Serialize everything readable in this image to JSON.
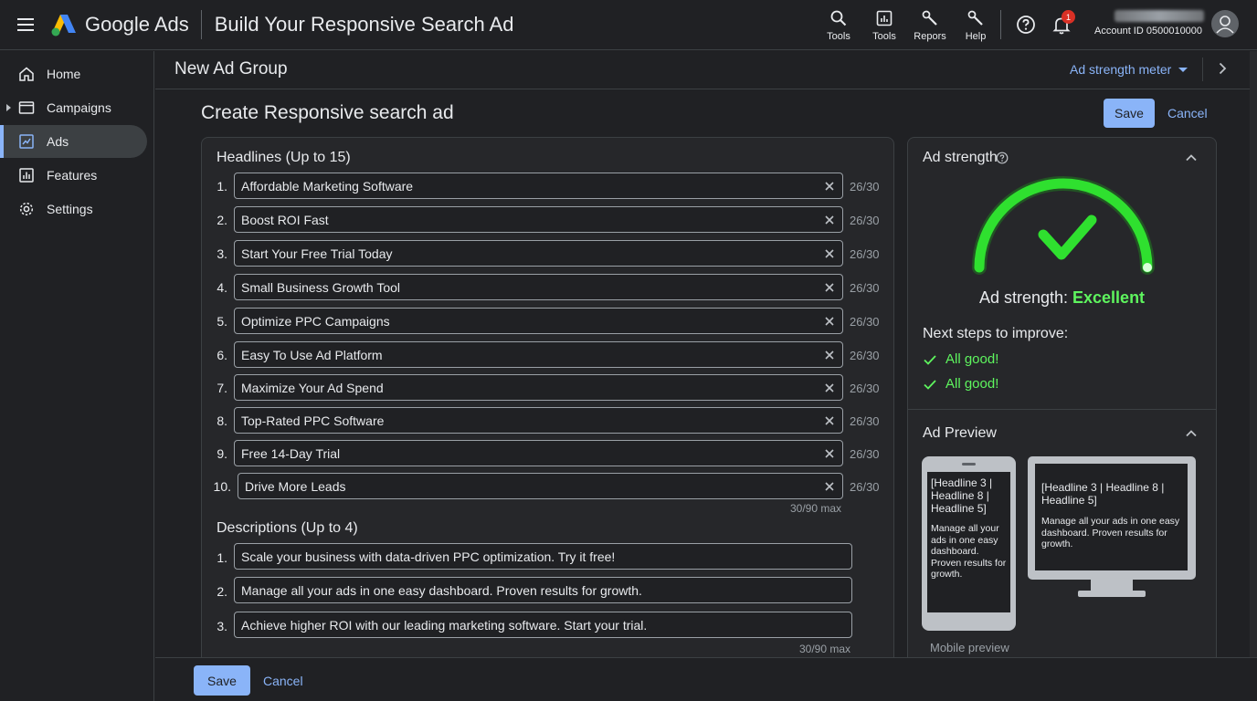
{
  "app": {
    "brand": "Google Ads",
    "page_title": "Build Your Responsive Search Ad"
  },
  "top_tools": [
    {
      "label": "Tools",
      "icon": "search-icon"
    },
    {
      "label": "Tools",
      "icon": "reports-chart-icon"
    },
    {
      "label": "Repors",
      "icon": "wrench-icon"
    },
    {
      "label": "Help",
      "icon": "wrench-icon"
    }
  ],
  "notifications": {
    "count": "1"
  },
  "account": {
    "id_label": "Account ID 0500010000"
  },
  "sidebar": {
    "items": [
      {
        "label": "Home",
        "icon": "home-icon"
      },
      {
        "label": "Campaigns",
        "icon": "campaigns-icon"
      },
      {
        "label": "Ads",
        "icon": "ads-icon",
        "active": true
      },
      {
        "label": "Features",
        "icon": "features-icon"
      },
      {
        "label": "Settings",
        "icon": "gear-icon"
      }
    ]
  },
  "subheader": {
    "title": "New Ad Group",
    "strength_meter": "Ad strength meter"
  },
  "main": {
    "title": "Create Responsive search ad",
    "save": "Save",
    "cancel": "Cancel"
  },
  "headlines": {
    "title": "Headlines (Up to 15)",
    "max_note": "30/90 max",
    "items": [
      {
        "num": "1.",
        "text": "Affordable Marketing Software",
        "count": "26/30"
      },
      {
        "num": "2.",
        "text": "Boost ROI Fast",
        "count": "26/30"
      },
      {
        "num": "3.",
        "text": "Start Your Free Trial Today",
        "count": "26/30"
      },
      {
        "num": "4.",
        "text": "Small Business Growth Tool",
        "count": "26/30"
      },
      {
        "num": "5.",
        "text": "Optimize PPC Campaigns",
        "count": "26/30"
      },
      {
        "num": "6.",
        "text": "Easy To Use Ad Platform",
        "count": "26/30"
      },
      {
        "num": "7.",
        "text": "Maximize Your Ad Spend",
        "count": "26/30"
      },
      {
        "num": "8.",
        "text": "Top-Rated PPC Software",
        "count": "26/30"
      },
      {
        "num": "9.",
        "text": "Free 14-Day Trial",
        "count": "26/30"
      },
      {
        "num": "10.",
        "text": "Drive More Leads",
        "count": "26/30"
      }
    ]
  },
  "descriptions": {
    "title": "Descriptions (Up to 4)",
    "max_note": "30/90 max",
    "items": [
      {
        "num": "1.",
        "text": "Scale your business with data-driven PPC optimization. Try it free!"
      },
      {
        "num": "2.",
        "text": "Manage all your ads in one easy dashboard. Proven results for growth."
      },
      {
        "num": "3.",
        "text": "Achieve higher ROI with our leading marketing software. Start your trial."
      }
    ]
  },
  "ad_strength": {
    "heading": "Ad strength",
    "label": "Ad strength:",
    "value": "Excellent",
    "next_steps": "Next steps to improve:",
    "items": [
      "All good!",
      "All good!"
    ],
    "color": "#5ef55e"
  },
  "ad_preview": {
    "heading": "Ad Preview",
    "mobile_headline": "[Headline 3 | Headline 8 | Headline 5]",
    "mobile_desc": "Manage all your ads in one easy dashboard. Proven results for growth.",
    "desktop_headline": "[Headline 3 | Headline 8 | Headline 5]",
    "desktop_desc": "Manage all your ads in one easy dashboard. Proven results for growth.",
    "mobile_caption": "Mobile preview"
  },
  "footer": {
    "save": "Save",
    "cancel": "Cancel"
  },
  "colors": {
    "accent": "#8ab4f8",
    "excellent": "#5ef55e",
    "background": "#202124"
  }
}
